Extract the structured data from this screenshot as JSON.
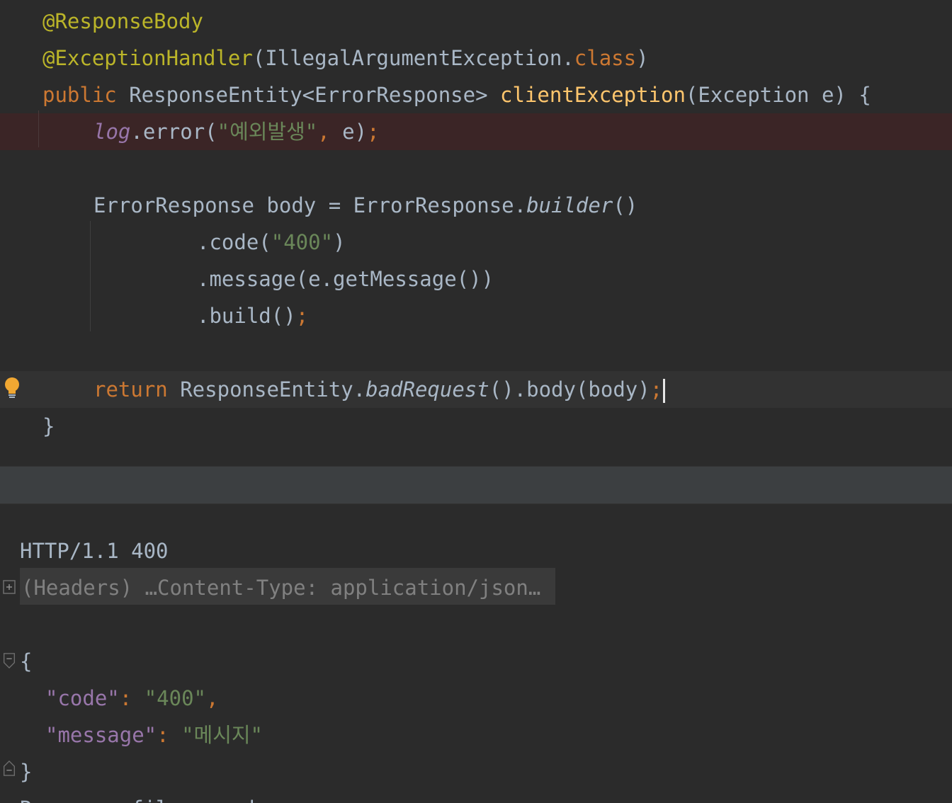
{
  "editor": {
    "l1_annotation": "@ResponseBody",
    "l2_annotation": "@ExceptionHandler",
    "l2_open": "(",
    "l2_class": "IllegalArgumentException.",
    "l2_kw": "class",
    "l2_close": ")",
    "l3_public": "public",
    "l3_type": " ResponseEntity<ErrorResponse> ",
    "l3_method": "clientException",
    "l3_params": "(Exception e) {",
    "l4_log": "log",
    "l4_call": ".error(",
    "l4_string": "\"예외발생\"",
    "l4_comma": ",",
    "l4_arg": " e)",
    "l4_semi": ";",
    "l6_decl": "ErrorResponse body = ErrorResponse.",
    "l6_builder": "builder",
    "l6_parens": "()",
    "l7_code_call": ".code(",
    "l7_code_val": "\"400\"",
    "l7_close": ")",
    "l8_message": ".message(e.getMessage())",
    "l9_build": ".build()",
    "l9_semi": ";",
    "l11_return": "return",
    "l11_entity": " ResponseEntity.",
    "l11_badrequest": "badRequest",
    "l11_body": "().body(body)",
    "l11_semi": ";",
    "l12_brace": "}"
  },
  "response": {
    "status_line": "HTTP/1.1 400",
    "headers_collapsed": "(Headers) …Content-Type: application/json…",
    "json_open": "{",
    "code_key": "\"code\"",
    "code_colon": ": ",
    "code_value": "\"400\"",
    "code_comma": ",",
    "message_key": "\"message\"",
    "message_colon": ": ",
    "message_value": "\"메시지\"",
    "json_close": "}",
    "footer_partial": "Response file saved."
  },
  "icons": {
    "bulb": "lightbulb-icon",
    "expand": "expand-plus-icon",
    "fold_start": "fold-start-icon",
    "fold_end": "fold-end-icon"
  },
  "colors": {
    "background": "#2b2b2b",
    "keyword": "#cc7832",
    "annotation": "#bbb529",
    "string": "#6a8759",
    "method": "#ffc66d",
    "static_field": "#9876aa",
    "default_text": "#a9b7c6",
    "error_line_bg": "#3b2526",
    "bulb": "#f0a732"
  }
}
